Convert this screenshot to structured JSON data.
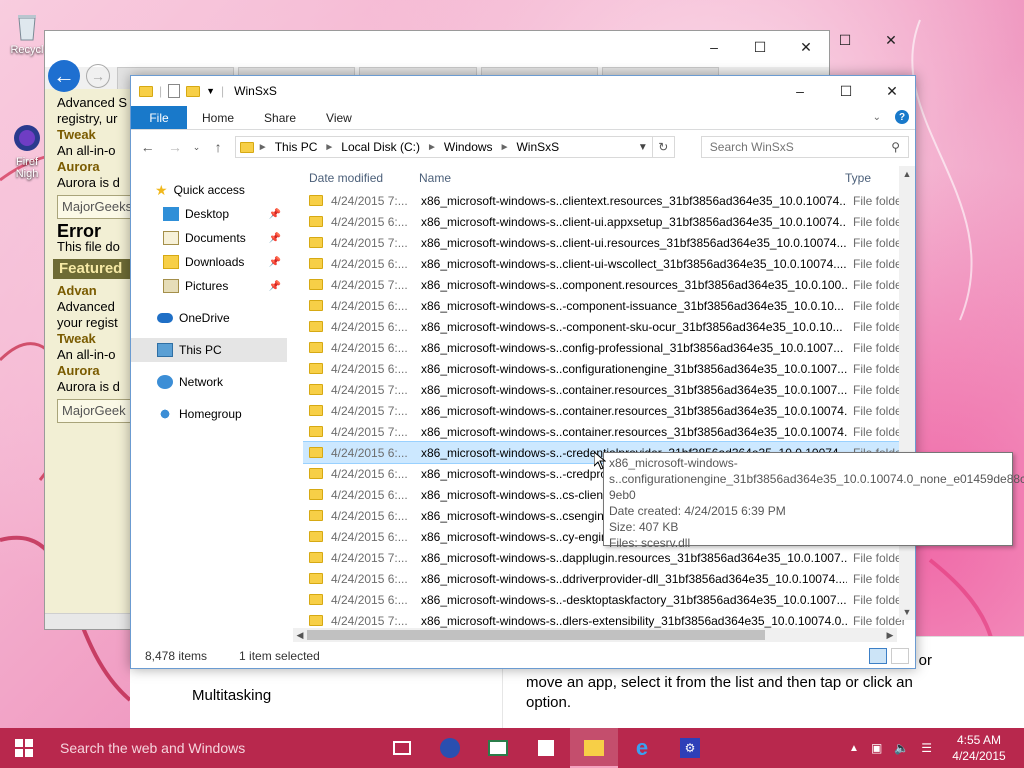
{
  "desktop": {
    "icons": [
      {
        "label": "Recycl"
      },
      {
        "label": "Firef Nigh"
      }
    ]
  },
  "browser": {
    "sidebar_lines": [
      {
        "text": "Advanced S",
        "style": "row"
      },
      {
        "text": "registry, ur",
        "style": "row"
      },
      {
        "text": "Tweak",
        "style": "bold"
      },
      {
        "text": "An all-in-o",
        "style": "row"
      },
      {
        "text": "Aurora",
        "style": "bold"
      },
      {
        "text": "Aurora is d",
        "style": "row"
      },
      {
        "text": "MajorGeeks",
        "style": "boxed"
      },
      {
        "text": "Error",
        "style": "err"
      },
      {
        "text": "This file do",
        "style": "row"
      },
      {
        "text": "Featured",
        "style": "feat"
      },
      {
        "text": "Advan",
        "style": "bold"
      },
      {
        "text": "Advanced",
        "style": "row"
      },
      {
        "text": "your regist",
        "style": "row"
      },
      {
        "text": "Tweak",
        "style": "bold"
      },
      {
        "text": "An all-in-o",
        "style": "row"
      },
      {
        "text": "Aurora",
        "style": "bold"
      },
      {
        "text": "Aurora is d",
        "style": "row"
      },
      {
        "text": "MajorGeek",
        "style": "boxed"
      }
    ]
  },
  "settings": {
    "left_label": "Multitasking",
    "help_text": "move an app, select it from the list and then tap or click an option.",
    "help_text_tail": "l or"
  },
  "explorer": {
    "title": "WinSxS",
    "ribbon": {
      "file": "File",
      "tabs": [
        "Home",
        "Share",
        "View"
      ]
    },
    "address": [
      "This PC",
      "Local Disk (C:)",
      "Windows",
      "WinSxS"
    ],
    "search_placeholder": "Search WinSxS",
    "nav": {
      "quick_access": "Quick access",
      "pinned": [
        "Desktop",
        "Documents",
        "Downloads",
        "Pictures"
      ],
      "onedrive": "OneDrive",
      "this_pc": "This PC",
      "network": "Network",
      "homegroup": "Homegroup"
    },
    "columns": {
      "date": "Date modified",
      "name": "Name",
      "type": "Type"
    },
    "rows": [
      {
        "date": "4/24/2015 7:...",
        "name": "x86_microsoft-windows-s..clientext.resources_31bf3856ad364e35_10.0.10074....",
        "type": "File folder"
      },
      {
        "date": "4/24/2015 6:...",
        "name": "x86_microsoft-windows-s..client-ui.appxsetup_31bf3856ad364e35_10.0.10074...",
        "type": "File folder"
      },
      {
        "date": "4/24/2015 7:...",
        "name": "x86_microsoft-windows-s..client-ui.resources_31bf3856ad364e35_10.0.10074....",
        "type": "File folder"
      },
      {
        "date": "4/24/2015 6:...",
        "name": "x86_microsoft-windows-s..client-ui-wscollect_31bf3856ad364e35_10.0.10074....",
        "type": "File folder"
      },
      {
        "date": "4/24/2015 7:...",
        "name": "x86_microsoft-windows-s..component.resources_31bf3856ad364e35_10.0.100...",
        "type": "File folder"
      },
      {
        "date": "4/24/2015 6:...",
        "name": "x86_microsoft-windows-s..-component-issuance_31bf3856ad364e35_10.0.10...",
        "type": "File folder"
      },
      {
        "date": "4/24/2015 6:...",
        "name": "x86_microsoft-windows-s..-component-sku-ocur_31bf3856ad364e35_10.0.10...",
        "type": "File folder"
      },
      {
        "date": "4/24/2015 6:...",
        "name": "x86_microsoft-windows-s..config-professional_31bf3856ad364e35_10.0.1007...",
        "type": "File folder"
      },
      {
        "date": "4/24/2015 6:...",
        "name": "x86_microsoft-windows-s..configurationengine_31bf3856ad364e35_10.0.1007...",
        "type": "File folder"
      },
      {
        "date": "4/24/2015 7:...",
        "name": "x86_microsoft-windows-s..container.resources_31bf3856ad364e35_10.0.1007...",
        "type": "File folder"
      },
      {
        "date": "4/24/2015 7:...",
        "name": "x86_microsoft-windows-s..container.resources_31bf3856ad364e35_10.0.10074...",
        "type": "File folder"
      },
      {
        "date": "4/24/2015 7:...",
        "name": "x86_microsoft-windows-s..container.resources_31bf3856ad364e35_10.0.10074...",
        "type": "File folder"
      },
      {
        "date": "4/24/2015 6:...",
        "name": "x86_microsoft-windows-s..-credentialprovider_31bf3856ad364e35_10.0.10074...",
        "type": "File folder",
        "selected": true
      },
      {
        "date": "4/24/2015 6:...",
        "name": "x86_microsoft-windows-s..-credpro",
        "type": "File folder"
      },
      {
        "date": "4/24/2015 6:...",
        "name": "x86_microsoft-windows-s..cs-client",
        "type": "File folder"
      },
      {
        "date": "4/24/2015 6:...",
        "name": "x86_microsoft-windows-s..csengine",
        "type": "File folder"
      },
      {
        "date": "4/24/2015 6:...",
        "name": "x86_microsoft-windows-s..cy-engine",
        "type": "File folder"
      },
      {
        "date": "4/24/2015 7:...",
        "name": "x86_microsoft-windows-s..dapplugin.resources_31bf3856ad364e35_10.0.1007...",
        "type": "File folder"
      },
      {
        "date": "4/24/2015 6:...",
        "name": "x86_microsoft-windows-s..ddriverprovider-dll_31bf3856ad364e35_10.0.10074....",
        "type": "File folder"
      },
      {
        "date": "4/24/2015 6:...",
        "name": "x86_microsoft-windows-s..-desktoptaskfactory_31bf3856ad364e35_10.0.1007...",
        "type": "File folder"
      },
      {
        "date": "4/24/2015 7:...",
        "name": "x86_microsoft-windows-s..dlers-extensibility_31bf3856ad364e35_10.0.10074.0...",
        "type": "File folder"
      }
    ],
    "tooltip": {
      "lines": [
        "x86_microsoft-windows-",
        "s..configurationengine_31bf3856ad364e35_10.0.10074.0_none_e01459de88ce",
        "9eb0",
        "Date created: 4/24/2015 6:39 PM",
        "Size: 407 KB",
        "Files: scesrv.dll"
      ]
    },
    "status": {
      "items": "8,478 items",
      "selected": "1 item selected"
    }
  },
  "taskbar": {
    "search_placeholder": "Search the web and Windows",
    "time": "4:55 AM",
    "date": "4/24/2015"
  },
  "colors": {
    "taskbar": "#b8284d",
    "file_tab": "#1979ca",
    "selection": "#cce8ff",
    "folder": "#f7cf47"
  }
}
